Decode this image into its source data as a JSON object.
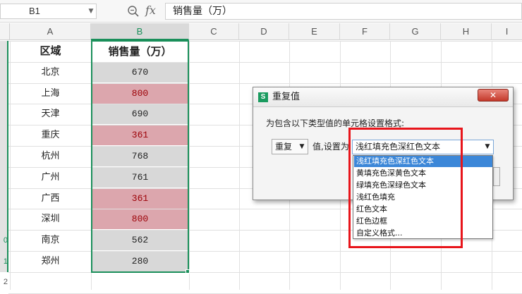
{
  "formula_bar": {
    "name_box": "B1",
    "fx": "fx",
    "formula": "销售量（万）",
    "zoom_icon": "zoom-search-icon"
  },
  "columns": [
    "A",
    "B",
    "C",
    "D",
    "E",
    "F",
    "G",
    "H",
    "I"
  ],
  "selected_column": "B",
  "rows": [
    {
      "region": "区域",
      "sales": "销售量（万）",
      "dup": false
    },
    {
      "region": "北京",
      "sales": "670",
      "dup": false
    },
    {
      "region": "上海",
      "sales": "800",
      "dup": true
    },
    {
      "region": "天津",
      "sales": "690",
      "dup": false
    },
    {
      "region": "重庆",
      "sales": "361",
      "dup": true
    },
    {
      "region": "杭州",
      "sales": "768",
      "dup": false
    },
    {
      "region": "广州",
      "sales": "761",
      "dup": false
    },
    {
      "region": "广西",
      "sales": "361",
      "dup": true
    },
    {
      "region": "深圳",
      "sales": "800",
      "dup": true
    },
    {
      "region": "南京",
      "sales": "562",
      "dup": false
    },
    {
      "region": "郑州",
      "sales": "280",
      "dup": false
    }
  ],
  "row_header_numbers": [
    "",
    "",
    "",
    "",
    "",
    "",
    "",
    "",
    "",
    "0",
    "1",
    "2"
  ],
  "colors": {
    "accent": "#1a8f5a",
    "dup_fill": "#dca6ad",
    "dup_text": "#9c0006",
    "plain_fill": "#d8d8d8",
    "annotation_red": "#e8151b",
    "list_highlight": "#3c87d8"
  },
  "dialog": {
    "title": "重复值",
    "icon": "S",
    "close": "✕",
    "prompt": "为包含以下类型值的单元格设置格式:",
    "dup_select": "重复",
    "set_label": "值,设置为",
    "format_select": "浅红填充色深红色文本",
    "options": [
      "浅红填充色深红色文本",
      "黄填充色深黄色文本",
      "绿填充色深绿色文本",
      "浅红色填充",
      "红色文本",
      "红色边框",
      "自定义格式..."
    ],
    "selected_index": 0
  }
}
